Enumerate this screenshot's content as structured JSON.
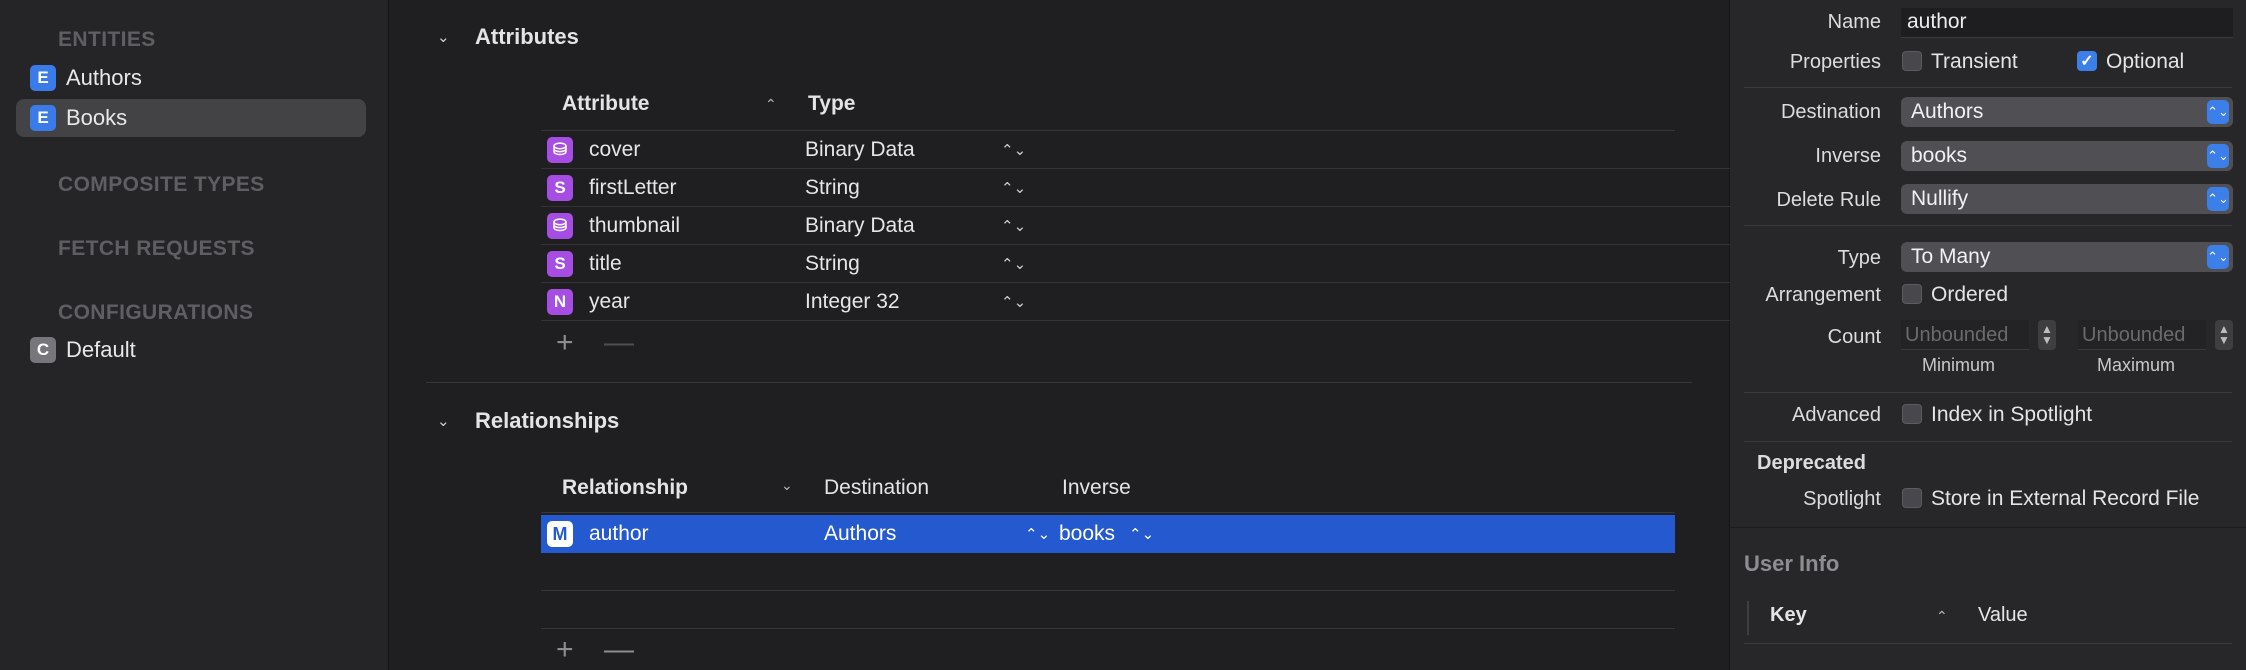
{
  "sidebar": {
    "entities_heading": "ENTITIES",
    "entities": [
      {
        "badge": "E",
        "label": "Authors"
      },
      {
        "badge": "E",
        "label": "Books"
      }
    ],
    "composite_types_heading": "COMPOSITE TYPES",
    "fetch_requests_heading": "FETCH REQUESTS",
    "configurations_heading": "CONFIGURATIONS",
    "configurations": [
      {
        "badge": "C",
        "label": "Default"
      }
    ]
  },
  "attributes": {
    "section_title": "Attributes",
    "col_attribute": "Attribute",
    "col_type": "Type",
    "rows": [
      {
        "icon": "⛁",
        "name": "cover",
        "type": "Binary Data"
      },
      {
        "icon": "S",
        "name": "firstLetter",
        "type": "String"
      },
      {
        "icon": "⛁",
        "name": "thumbnail",
        "type": "Binary Data"
      },
      {
        "icon": "S",
        "name": "title",
        "type": "String"
      },
      {
        "icon": "N",
        "name": "year",
        "type": "Integer 32"
      }
    ]
  },
  "relationships": {
    "section_title": "Relationships",
    "col_relationship": "Relationship",
    "col_destination": "Destination",
    "col_inverse": "Inverse",
    "rows": [
      {
        "icon": "M",
        "name": "author",
        "destination": "Authors",
        "inverse": "books"
      }
    ]
  },
  "controls": {
    "add": "+",
    "remove": "—",
    "stepper": "⌃⌄"
  },
  "inspector": {
    "name_label": "Name",
    "name_value": "author",
    "properties_label": "Properties",
    "transient_label": "Transient",
    "transient_checked": false,
    "optional_label": "Optional",
    "optional_checked": true,
    "destination_label": "Destination",
    "destination_value": "Authors",
    "inverse_label": "Inverse",
    "inverse_value": "books",
    "delete_rule_label": "Delete Rule",
    "delete_rule_value": "Nullify",
    "type_label": "Type",
    "type_value": "To Many",
    "arrangement_label": "Arrangement",
    "ordered_label": "Ordered",
    "count_label": "Count",
    "min_placeholder": "Unbounded",
    "max_placeholder": "Unbounded",
    "minimum_label": "Minimum",
    "maximum_label": "Maximum",
    "advanced_label": "Advanced",
    "index_spotlight_label": "Index in Spotlight",
    "deprecated_label": "Deprecated",
    "spotlight_label": "Spotlight",
    "external_record_label": "Store in External Record File",
    "user_info_title": "User Info",
    "key_col": "Key",
    "value_col": "Value"
  },
  "colors": {
    "accent": "#3c7fe9",
    "selection": "#2559cf",
    "entity_badge": "#3a7be8",
    "attribute_badge": "#a64ee3"
  }
}
